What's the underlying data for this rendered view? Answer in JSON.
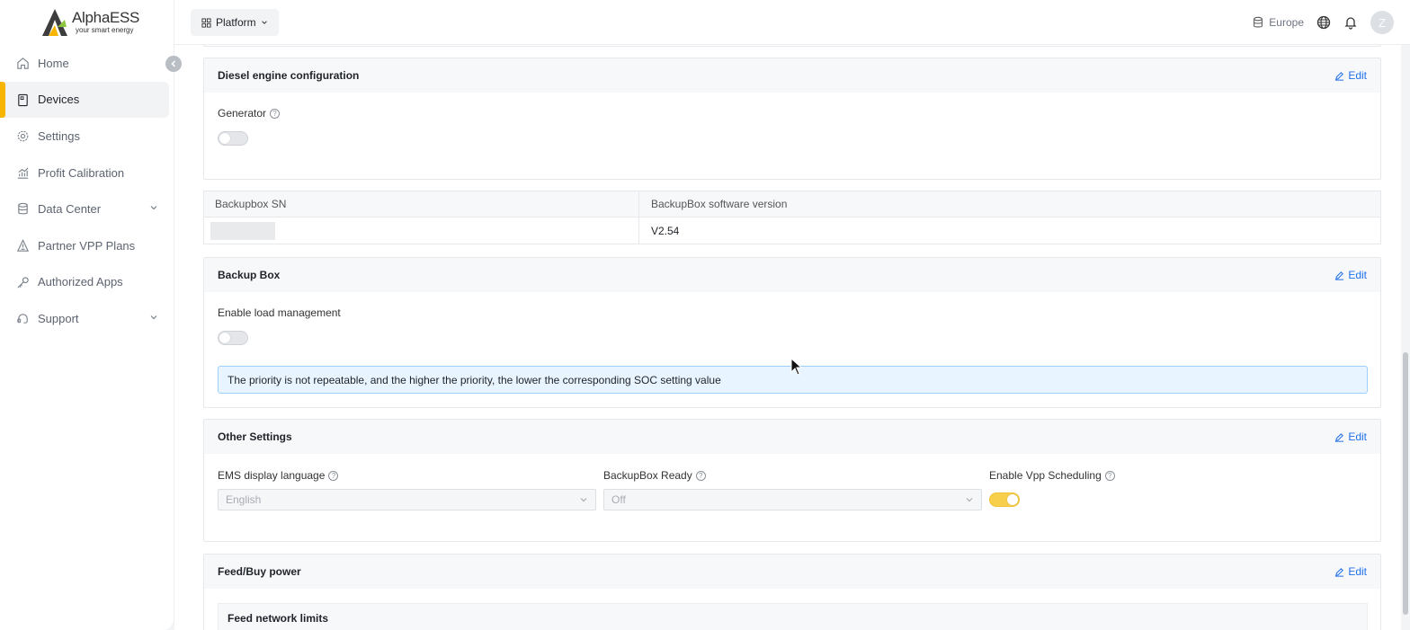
{
  "brand": {
    "name": "AlphaESS",
    "tagline": "your smart energy"
  },
  "sidebar": {
    "items": [
      {
        "label": "Home",
        "icon": "home-icon"
      },
      {
        "label": "Devices",
        "icon": "device-icon",
        "active": true
      },
      {
        "label": "Settings",
        "icon": "gear-icon"
      },
      {
        "label": "Profit Calibration",
        "icon": "chart-icon"
      },
      {
        "label": "Data Center",
        "icon": "database-icon",
        "expandable": true
      },
      {
        "label": "Partner VPP Plans",
        "icon": "plans-icon"
      },
      {
        "label": "Authorized Apps",
        "icon": "key-icon"
      },
      {
        "label": "Support",
        "icon": "support-icon",
        "expandable": true
      }
    ]
  },
  "topbar": {
    "platform_label": "Platform",
    "region": "Europe",
    "avatar_initial": "Z"
  },
  "sections": {
    "diesel": {
      "title": "Diesel engine configuration",
      "edit_label": "Edit",
      "generator_label": "Generator",
      "generator_on": false
    },
    "backupbox_table": {
      "col1": "Backupbox SN",
      "col2": "BackupBox software version",
      "sn_value": "",
      "version_value": "V2.54"
    },
    "backup_box": {
      "title": "Backup Box",
      "edit_label": "Edit",
      "load_mgmt_label": "Enable load management",
      "load_mgmt_on": false,
      "info_text": "The priority is not repeatable, and the higher the priority, the lower the corresponding SOC setting value"
    },
    "other": {
      "title": "Other Settings",
      "edit_label": "Edit",
      "ems_lang_label": "EMS display language",
      "ems_lang_value": "English",
      "bb_ready_label": "BackupBox Ready",
      "bb_ready_value": "Off",
      "vpp_label": "Enable Vpp Scheduling",
      "vpp_on": true
    },
    "feed": {
      "title": "Feed/Buy power",
      "edit_label": "Edit",
      "sub_title": "Feed network limits"
    }
  },
  "colors": {
    "accent": "#f7b500",
    "link": "#1f6feb",
    "info_bg": "#e8f4ff"
  }
}
